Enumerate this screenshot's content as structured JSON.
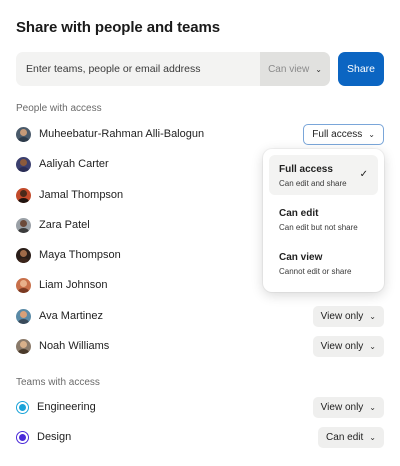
{
  "header": {
    "title": "Share with people and teams"
  },
  "share": {
    "placeholder": "Enter teams, people or email address",
    "permission": "Can view",
    "button": "Share"
  },
  "people_section": {
    "label": "People with access"
  },
  "people": [
    {
      "name": "Muheebatur-Rahman Alli-Balogun",
      "role": "Full access",
      "avatar_bg": "#4a5a6a",
      "avatar_head": "#c69a78",
      "avatar_body": "#2d3b4a"
    },
    {
      "name": "Aaliyah Carter",
      "role": "",
      "avatar_bg": "#3b3f6e",
      "avatar_head": "#8b5a3c",
      "avatar_body": "#2a2d55"
    },
    {
      "name": "Jamal Thompson",
      "role": "",
      "avatar_bg": "#c24a2a",
      "avatar_head": "#4a2a1a",
      "avatar_body": "#1f1410"
    },
    {
      "name": "Zara Patel",
      "role": "",
      "avatar_bg": "#9aa0a6",
      "avatar_head": "#6b4a3a",
      "avatar_body": "#3b3b3b"
    },
    {
      "name": "Maya Thompson",
      "role": "",
      "avatar_bg": "#2a1d18",
      "avatar_head": "#a06a48",
      "avatar_body": "#3b241a"
    },
    {
      "name": "Liam Johnson",
      "role": "",
      "avatar_bg": "#c8704a",
      "avatar_head": "#e8b08a",
      "avatar_body": "#7a3a22"
    },
    {
      "name": "Ava Martinez",
      "role": "View only",
      "avatar_bg": "#5a8aa6",
      "avatar_head": "#d8a078",
      "avatar_body": "#3a4a5a"
    },
    {
      "name": "Noah Williams",
      "role": "View only",
      "avatar_bg": "#8a7a6a",
      "avatar_head": "#d8b08a",
      "avatar_body": "#4a3a2a"
    }
  ],
  "teams_section": {
    "label": "Teams with access"
  },
  "teams": [
    {
      "name": "Engineering",
      "role": "View only",
      "color": "#1aa3d9"
    },
    {
      "name": "Design",
      "role": "Can edit",
      "color": "#4a2ad9"
    }
  ],
  "menu": {
    "items": [
      {
        "title": "Full access",
        "desc": "Can edit and share",
        "selected": true
      },
      {
        "title": "Can edit",
        "desc": "Can edit but not share",
        "selected": false
      },
      {
        "title": "Can view",
        "desc": "Cannot edit or share",
        "selected": false
      }
    ],
    "check_icon": "check-icon"
  },
  "colors": {
    "primary": "#0b65c2"
  }
}
